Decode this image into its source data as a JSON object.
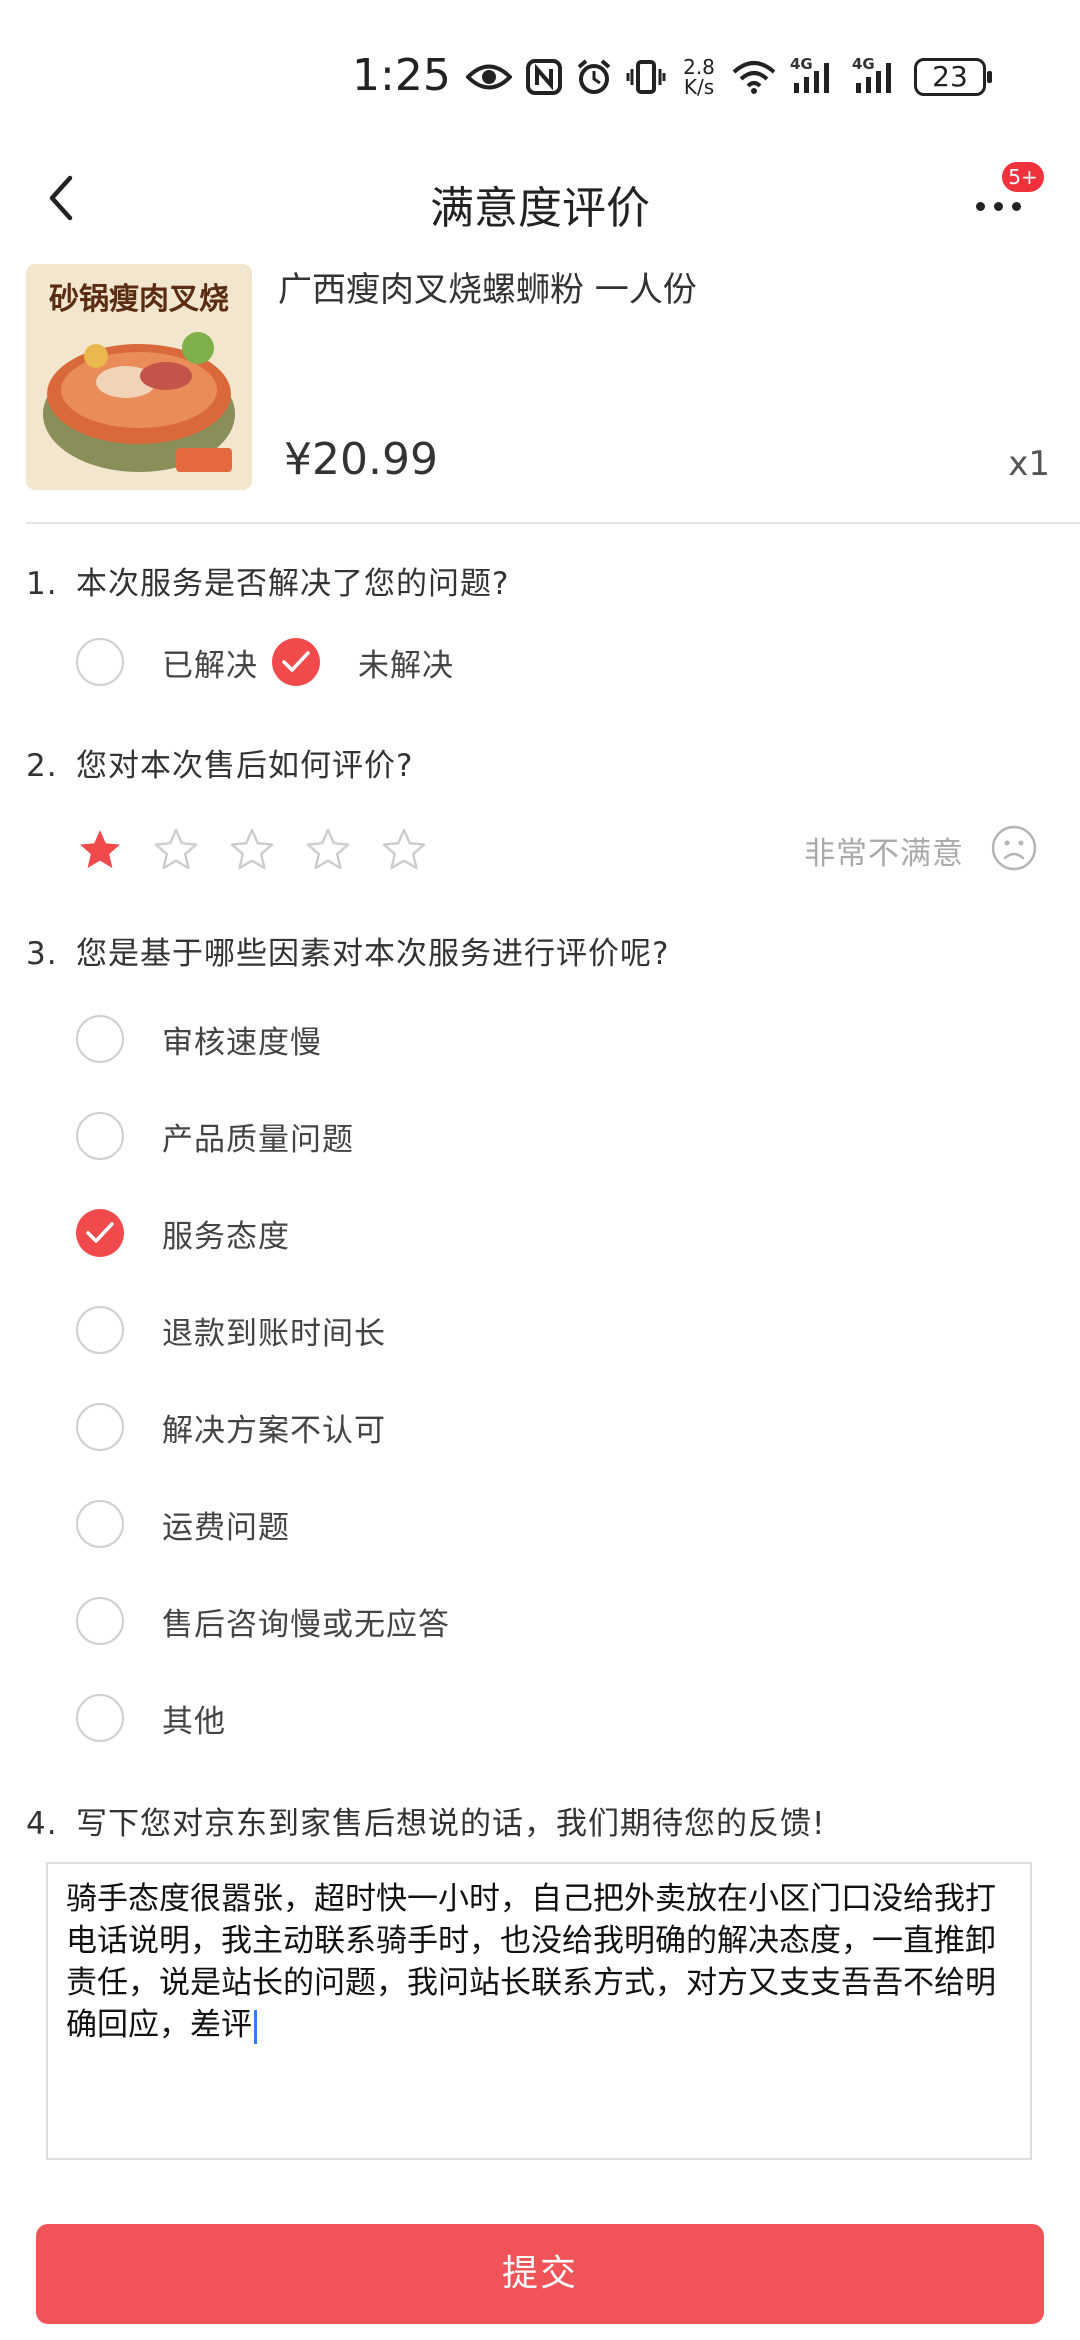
{
  "status_bar": {
    "time": "1:25",
    "net_speed_value": "2.8",
    "net_speed_unit": "K/s",
    "signal1_label": "4G",
    "signal2_label": "4G",
    "battery": "23"
  },
  "header": {
    "title": "满意度评价",
    "badge": "5+"
  },
  "product": {
    "name": "广西瘦肉叉烧螺蛳粉 一人份",
    "price": "¥20.99",
    "quantity": "x1",
    "image_text": "砂锅瘦肉叉烧"
  },
  "questions": {
    "q1": {
      "number": "1.",
      "text": "本次服务是否解决了您的问题?",
      "options": [
        {
          "label": "已解决",
          "checked": false
        },
        {
          "label": "未解决",
          "checked": true
        }
      ]
    },
    "q2": {
      "number": "2.",
      "text": "您对本次售后如何评价?",
      "rating": 1,
      "max_rating": 5,
      "rating_text": "非常不满意"
    },
    "q3": {
      "number": "3.",
      "text": "您是基于哪些因素对本次服务进行评价呢?",
      "options": [
        {
          "label": "审核速度慢",
          "checked": false
        },
        {
          "label": "产品质量问题",
          "checked": false
        },
        {
          "label": "服务态度",
          "checked": true
        },
        {
          "label": "退款到账时间长",
          "checked": false
        },
        {
          "label": "解决方案不认可",
          "checked": false
        },
        {
          "label": "运费问题",
          "checked": false
        },
        {
          "label": "售后咨询慢或无应答",
          "checked": false
        },
        {
          "label": "其他",
          "checked": false
        }
      ]
    },
    "q4": {
      "number": "4.",
      "text": "写下您对京东到家售后想说的话，我们期待您的反馈!",
      "value": "骑手态度很嚣张，超时快一小时，自己把外卖放在小区门口没给我打电话说明，我主动联系骑手时，也没给我明确的解决态度，一直推卸责任，说是站长的问题，我问站长联系方式，对方又支支吾吾不给明确回应，差评"
    }
  },
  "submit": {
    "label": "提交"
  },
  "colors": {
    "accent": "#f04a4d",
    "button": "#f05458",
    "star_empty": "#cccccc",
    "muted": "#aaaaaa"
  }
}
